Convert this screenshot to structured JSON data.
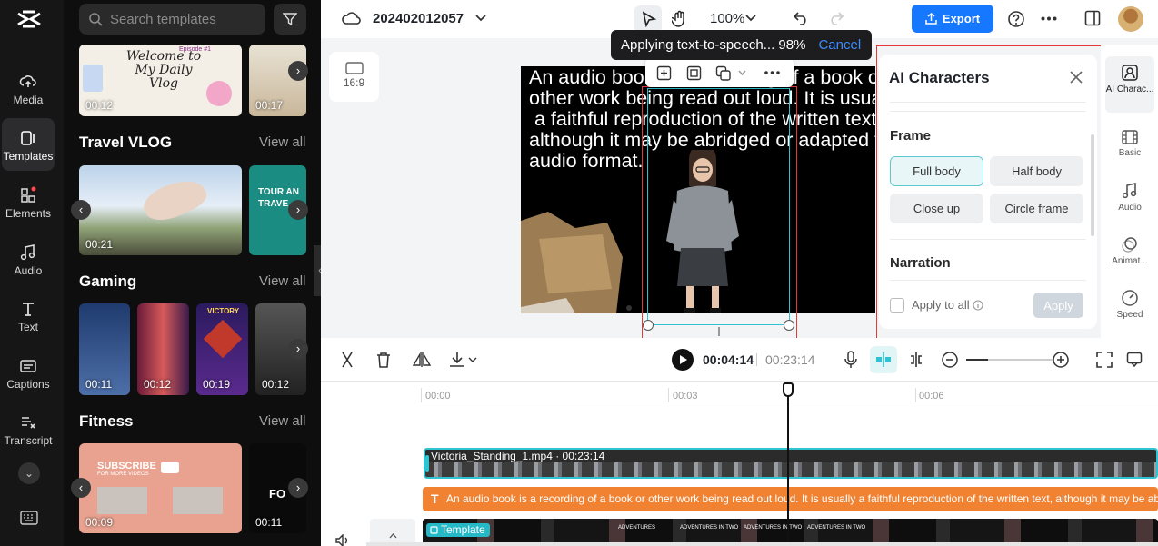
{
  "rail": {
    "items": [
      {
        "label": "Media"
      },
      {
        "label": "Templates"
      },
      {
        "label": "Elements"
      },
      {
        "label": "Audio"
      },
      {
        "label": "Text"
      },
      {
        "label": "Captions"
      },
      {
        "label": "Transcript"
      }
    ]
  },
  "panel": {
    "search_placeholder": "Search templates",
    "top_row": [
      {
        "duration": "00:12",
        "title": "Welcome to My Daily Vlog",
        "badge": "Episode #1"
      },
      {
        "duration": "00:17"
      }
    ],
    "sections": [
      {
        "title": "Travel VLOG",
        "view_all": "View all",
        "items": [
          {
            "duration": "00:21"
          },
          {
            "title": "TOUR AN TRAVE"
          }
        ]
      },
      {
        "title": "Gaming",
        "view_all": "View all",
        "items": [
          {
            "duration": "00:11"
          },
          {
            "duration": "00:12"
          },
          {
            "duration": "00:19",
            "title": "VICTORY"
          },
          {
            "duration": "00:12"
          }
        ]
      },
      {
        "title": "Fitness",
        "view_all": "View all",
        "items": [
          {
            "duration": "00:09",
            "title": "SUBSCRIBE",
            "subtitle": "FOR MORE VIDEOS"
          },
          {
            "duration": "00:11",
            "title": "FO"
          }
        ]
      }
    ]
  },
  "topbar": {
    "project_name": "202402012057",
    "zoom": "100%",
    "export_label": "Export"
  },
  "toast": {
    "message": "Applying text-to-speech... 98%",
    "cancel": "Cancel"
  },
  "canvas": {
    "ratio": "16:9",
    "caption": "An audio book is a recording of a book or\nother work being read out loud. It is usually\n a faithful reproduction of the written text,\nalthough it may be abridged or adapted for\naudio format."
  },
  "ai_panel": {
    "title": "AI Characters",
    "frame_label": "Frame",
    "frame_options": [
      "Full body",
      "Half body",
      "Close up",
      "Circle frame"
    ],
    "selected_frame": "Full body",
    "narration_label": "Narration",
    "apply_all": "Apply to all",
    "apply": "Apply"
  },
  "right_tabs": [
    {
      "label": "AI Charac..."
    },
    {
      "label": "Basic"
    },
    {
      "label": "Audio"
    },
    {
      "label": "Animat..."
    },
    {
      "label": "Speed"
    }
  ],
  "timeline": {
    "current_time": "00:04:14",
    "total_time": "00:23:14",
    "ruler": [
      "00:00",
      "00:03",
      "00:06"
    ],
    "video_clip": "Victoria_Standing_1.mp4 · 00:23:14",
    "text_clip": "An audio book is a recording of a book or  other work being read out loud. It is usually  a faithful reproduction of the written text,  although it may be abridged",
    "template_clip": "Template",
    "template_texts": [
      "ADVENTURES",
      "ADVENTURES IN TWO"
    ]
  },
  "colors": {
    "accent": "#1677ff",
    "selection": "#2fc3d1",
    "text_clip": "#f08232",
    "highlight": "#e53935"
  }
}
